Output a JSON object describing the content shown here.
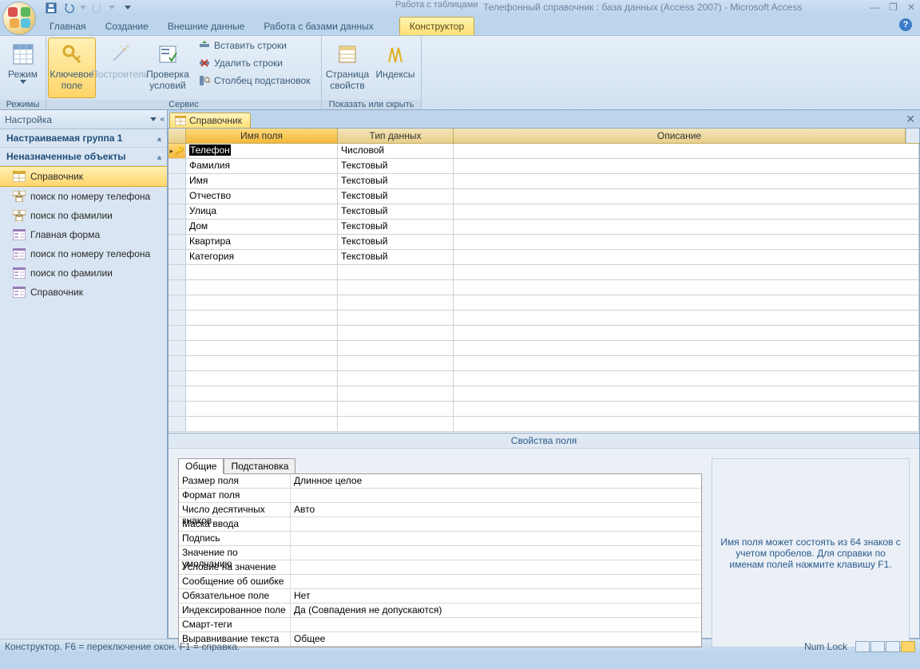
{
  "title_bar": {
    "context_label": "Работа с таблицами",
    "app_title": "Телефонный справочник : база данных (Access 2007) - Microsoft Access"
  },
  "ribbon": {
    "tabs": [
      "Главная",
      "Создание",
      "Внешние данные",
      "Работа с базами данных"
    ],
    "context_tab": "Конструктор",
    "groups": {
      "modes": {
        "label": "Режимы",
        "view": "Режим"
      },
      "service": {
        "label": "Сервис",
        "key_field": "Ключевое\nполе",
        "builder": "Построитель",
        "test_rules": "Проверка\nусловий",
        "insert_rows": "Вставить строки",
        "delete_rows": "Удалить строки",
        "lookup_col": "Столбец подстановок"
      },
      "show_hide": {
        "label": "Показать или скрыть",
        "prop_sheet": "Страница\nсвойств",
        "indexes": "Индексы"
      }
    }
  },
  "nav": {
    "header": "Настройка",
    "group1": "Настраиваемая группа 1",
    "group2": "Неназначенные объекты",
    "items": [
      {
        "label": "Справочник",
        "icon": "table"
      },
      {
        "label": "поиск по номеру телефона",
        "icon": "query"
      },
      {
        "label": "поиск по фамилии",
        "icon": "query"
      },
      {
        "label": "Главная форма",
        "icon": "form"
      },
      {
        "label": "поиск по номеру телефона",
        "icon": "form"
      },
      {
        "label": "поиск по фамилии",
        "icon": "form"
      },
      {
        "label": "Справочник",
        "icon": "form"
      }
    ]
  },
  "doc": {
    "tab_label": "Справочник",
    "columns": {
      "name": "Имя поля",
      "type": "Тип данных",
      "desc": "Описание"
    },
    "rows": [
      {
        "name": "Телефон",
        "type": "Числовой",
        "key": true
      },
      {
        "name": "Фамилия",
        "type": "Текстовый"
      },
      {
        "name": "Имя",
        "type": "Текстовый"
      },
      {
        "name": "Отчество",
        "type": "Текстовый"
      },
      {
        "name": "Улица",
        "type": "Текстовый"
      },
      {
        "name": "Дом",
        "type": "Текстовый"
      },
      {
        "name": "Квартира",
        "type": "Текстовый"
      },
      {
        "name": "Категория",
        "type": "Текстовый"
      }
    ],
    "blank_rows": 11
  },
  "field_props": {
    "title": "Свойства поля",
    "tabs": {
      "general": "Общие",
      "lookup": "Подстановка"
    },
    "rows": [
      {
        "label": "Размер поля",
        "value": "Длинное целое"
      },
      {
        "label": "Формат поля",
        "value": ""
      },
      {
        "label": "Число десятичных знаков",
        "value": "Авто"
      },
      {
        "label": "Маска ввода",
        "value": ""
      },
      {
        "label": "Подпись",
        "value": ""
      },
      {
        "label": "Значение по умолчанию",
        "value": ""
      },
      {
        "label": "Условие на значение",
        "value": ""
      },
      {
        "label": "Сообщение об ошибке",
        "value": ""
      },
      {
        "label": "Обязательное поле",
        "value": "Нет"
      },
      {
        "label": "Индексированное поле",
        "value": "Да (Совпадения не допускаются)"
      },
      {
        "label": "Смарт-теги",
        "value": ""
      },
      {
        "label": "Выравнивание текста",
        "value": "Общее"
      }
    ],
    "hint": "Имя поля может состоять из 64 знаков с учетом пробелов.  Для справки по именам полей нажмите клавишу F1."
  },
  "status": {
    "left": "Конструктор.  F6 = переключение окон.  F1 = справка.",
    "numlock": "Num Lock"
  }
}
